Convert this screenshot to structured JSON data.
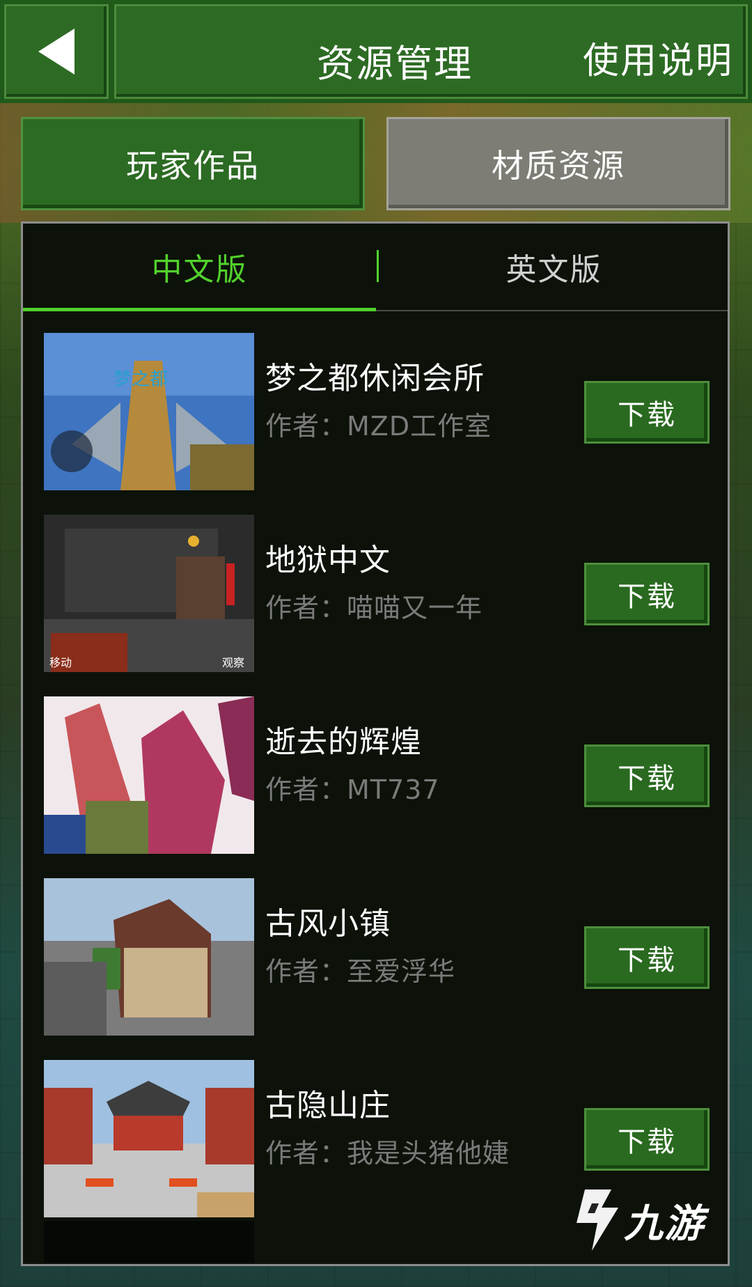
{
  "header": {
    "title": "资源管理",
    "help_label": "使用说明"
  },
  "categories": {
    "active": "玩家作品",
    "inactive": "材质资源"
  },
  "tabs": {
    "chinese": "中文版",
    "english": "英文版"
  },
  "items": [
    {
      "title": "梦之都休闲会所",
      "author": "作者：MZD工作室",
      "button": "下载"
    },
    {
      "title": "地狱中文",
      "author": "作者：喵喵又一年",
      "button": "下载"
    },
    {
      "title": "逝去的辉煌",
      "author": "作者：MT737",
      "button": "下载"
    },
    {
      "title": "古风小镇",
      "author": "作者：至爱浮华",
      "button": "下载"
    },
    {
      "title": "古隐山庄",
      "author": "作者：我是头猪他婕",
      "button": "下载"
    }
  ],
  "watermark": {
    "text": "九游"
  },
  "colors": {
    "accent_green": "#53d12e",
    "button_green": "#2a6a20",
    "panel_bg": "#0c1209"
  }
}
